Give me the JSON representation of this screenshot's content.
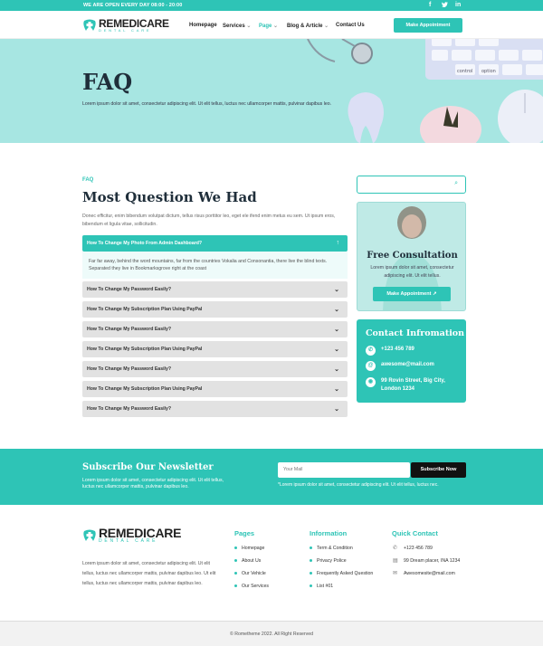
{
  "topbar": {
    "hours": "WE ARE OPEN EVERY DAY 08:00 - 20:00",
    "social": [
      "facebook-icon",
      "twitter-icon",
      "linkedin-icon"
    ]
  },
  "brand": {
    "name": "REMEDICARE",
    "tagline": "DENTAL CARE",
    "accent": "#2ec4b6"
  },
  "nav": {
    "items": [
      "Homepage",
      "Services",
      "Page",
      "Blog & Article",
      "Contact Us"
    ],
    "active": "Page",
    "cta": "Make Appointment"
  },
  "hero": {
    "title": "FAQ",
    "subtitle": "Lorem ipsum dolor sit amet, consectetur adipiscing elit. Ut elit tellus, luctus nec ullamcorper mattis, pulvinar dapibus leo."
  },
  "faq": {
    "eyebrow": "FAQ",
    "title": "Most Question We Had",
    "intro": "Donec efficitur, enim bibendum volutpat dictum, tellus risus porttitor leo, eget ele ifend enim metus eu sem. Ut ipsum eros, bibendum et ligula vitae, sollicitudin.",
    "items": [
      {
        "q": "How To Change My Photo From Admin Dashboard?"
      },
      {
        "q": "How To Change My Password Easily?"
      },
      {
        "q": "How To Change My Subscription Plan Using PayPal"
      },
      {
        "q": "How To Change My Password Easily?"
      },
      {
        "q": "How To Change My Subscription Plan Using PayPal"
      },
      {
        "q": "How To Change My Password Easily?"
      },
      {
        "q": "How To Change My Subscription Plan Using PayPal"
      },
      {
        "q": "How To Change My Password Easily?"
      }
    ],
    "open_answer": "Far far away, behind the word mountains, far from the countries Vokalia and Consonantia, there live the blind texts. Separated they live in Bookmarksgrove right at the coast"
  },
  "sidebar": {
    "search_placeholder": "",
    "consult": {
      "title": "Free Consultation",
      "text": "Lorem ipsum dolor sit amet, consectetur adipiscing elit. Ut elit tellus.",
      "button": "Make Appointment"
    },
    "contact": {
      "title": "Contact Infromation",
      "phone": "+123 456 789",
      "email": "awesome@mail.com",
      "address": "99 Rovin Street, Big City, London 1234"
    }
  },
  "newsletter": {
    "title": "Subscribe Our Newsletter",
    "text": "Lorem ipsum dolor sit amet, consectetur adipiscing elit. Ut elit tellus, luctus nec ullamcorper mattis, pulvinar dapibus leo.",
    "placeholder": "Your Mail",
    "button": "Subscribe Now",
    "note": "*Lorem ipsum dolor sit amet, consectetur adipiscing elit. Ut elit tellus, luctus nec."
  },
  "footer": {
    "about": "Lorem ipsum dolor sit amet, consectetur adipiscing elit. Ut elit tellus, luctus nec ullamcorper mattis, pulvinar dapibus leo. Ut elit tellus, luctus nec ullamcorper mattis, pulvinar dapibus leo.",
    "pages": {
      "title": "Pages",
      "items": [
        "Homepage",
        "About Us",
        "Our Vehicle",
        "Our Services"
      ]
    },
    "information": {
      "title": "Information",
      "items": [
        "Term & Condition",
        "Privacy Police",
        "Frequently Asked Question",
        "List #01"
      ]
    },
    "quick": {
      "title": "Quick Contact",
      "phone": "+123 456 789",
      "address": "99 Dream placer, INA 1234",
      "email": "Awesomesite@mail.com"
    },
    "copyright": "Rometheme 2022. All Right Reserved"
  }
}
